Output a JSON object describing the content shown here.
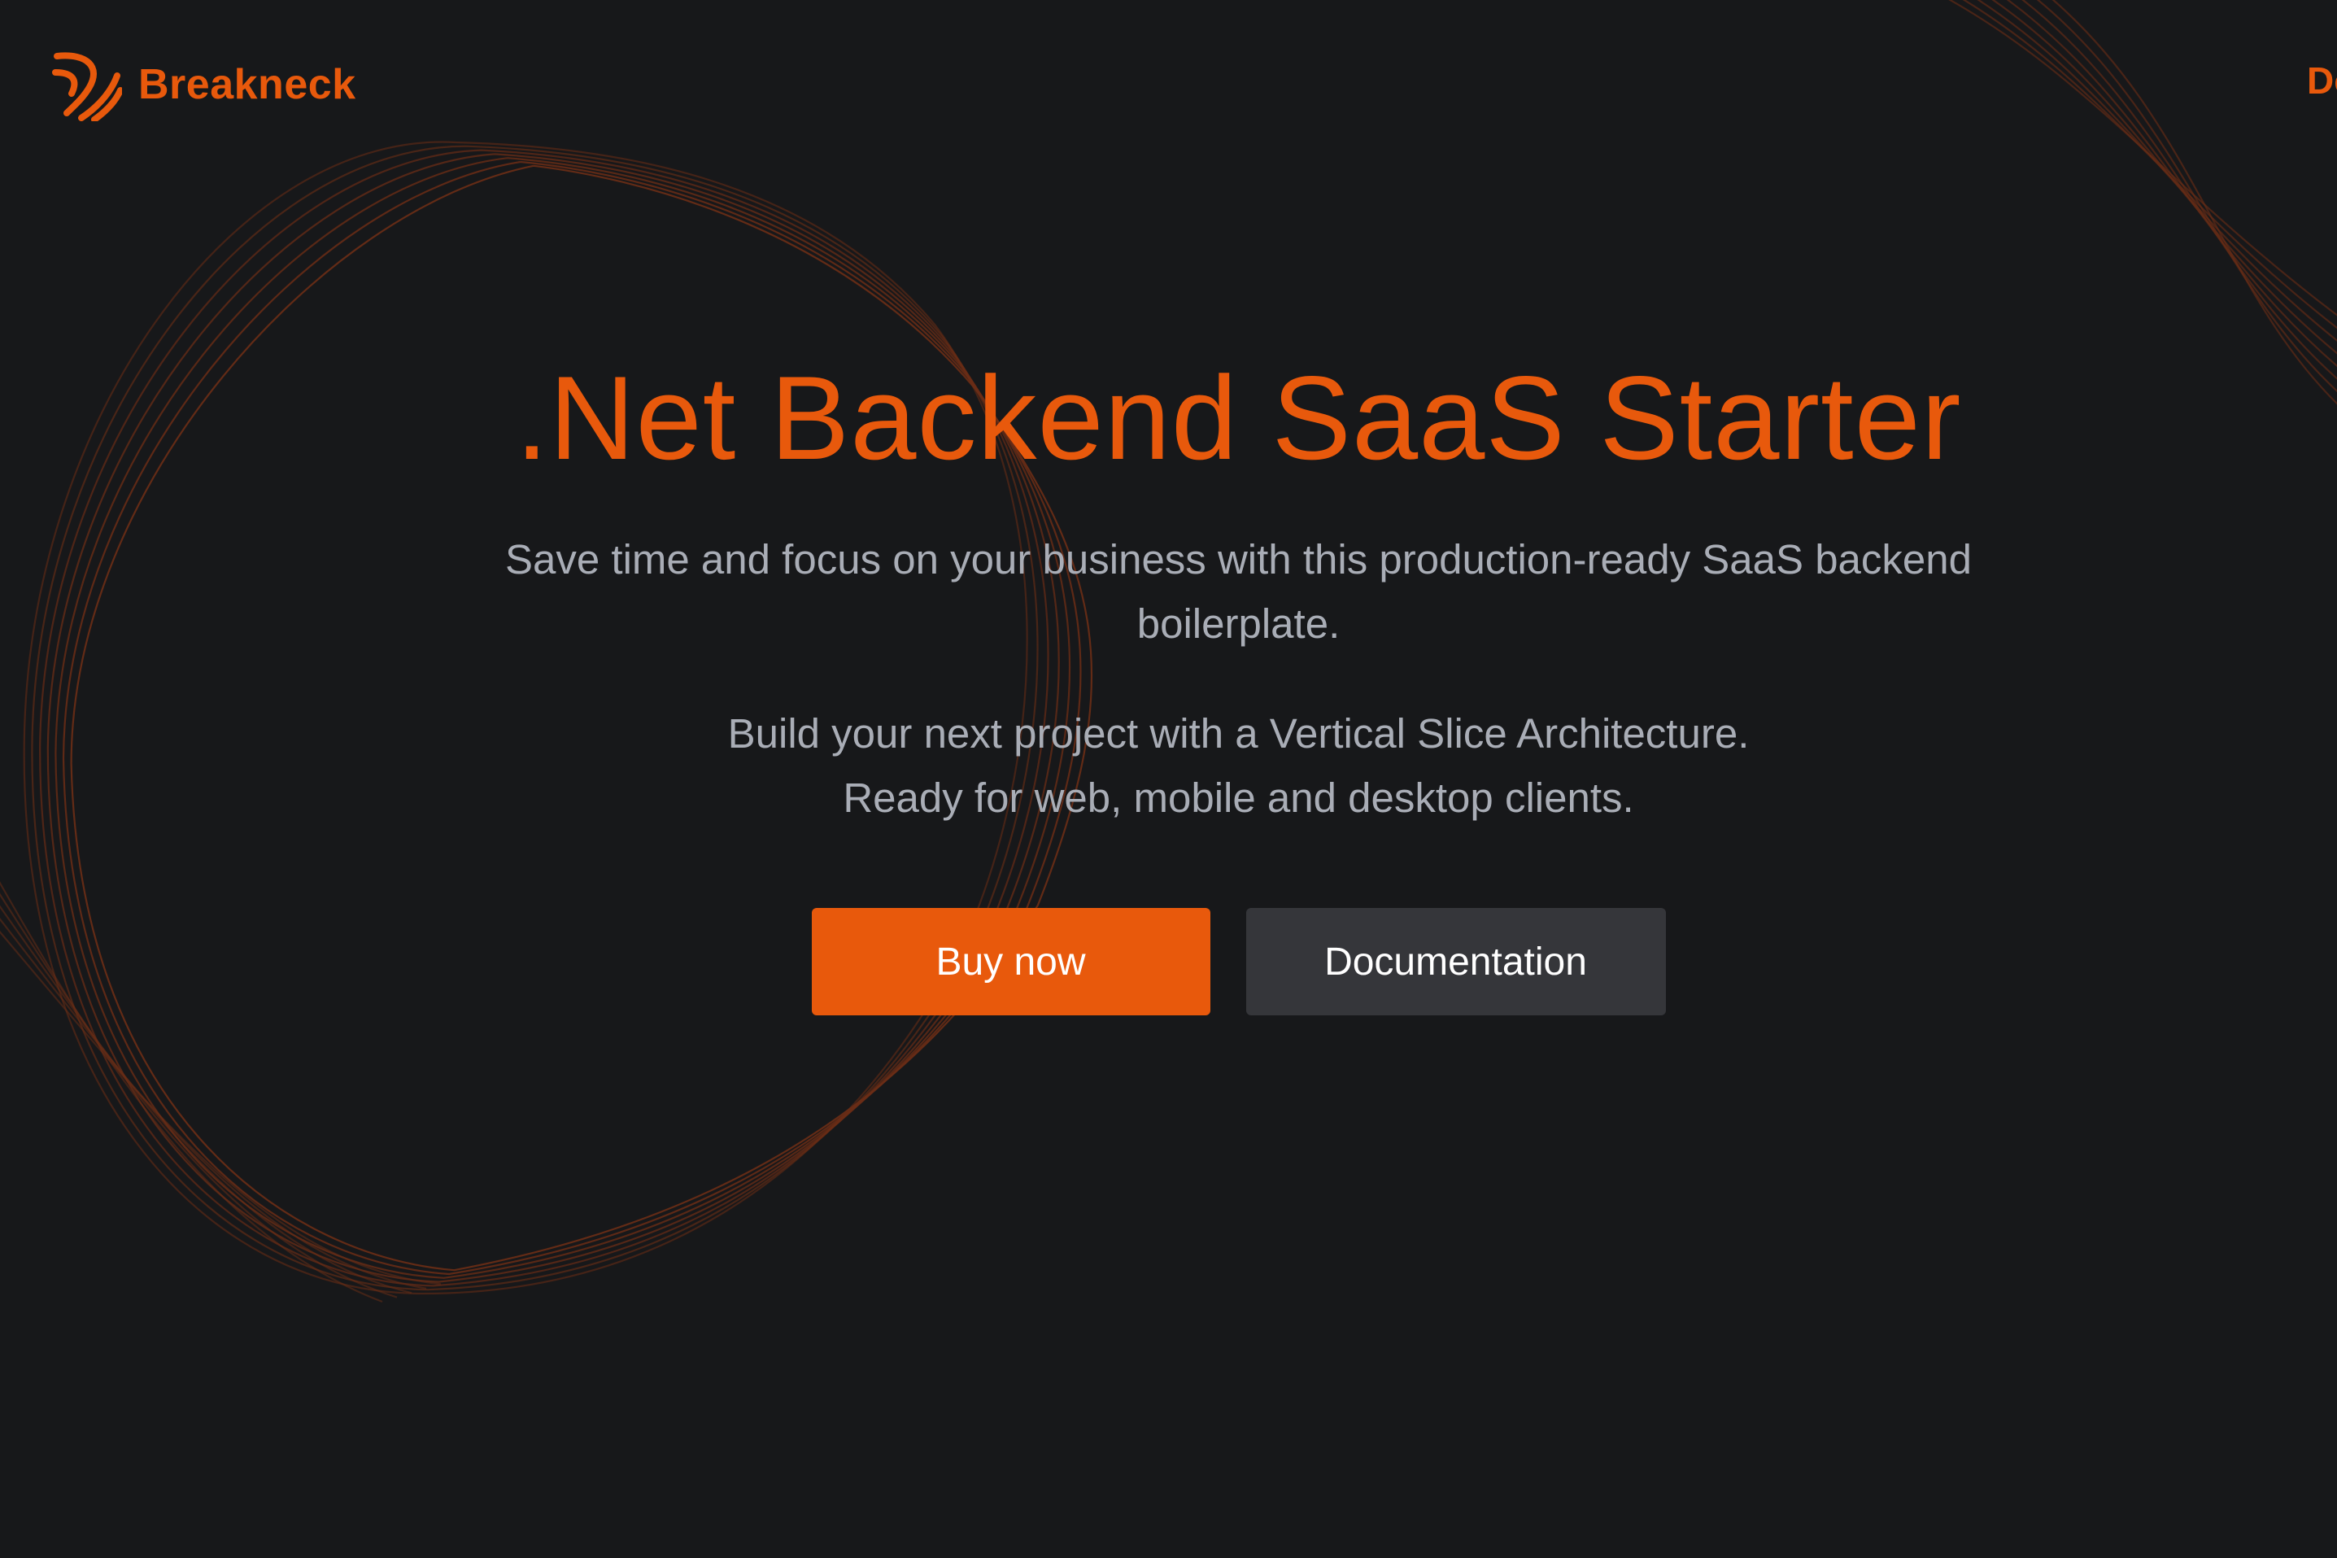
{
  "colors": {
    "accent": "#e8590c",
    "background": "#17181a",
    "body_text": "#a9adb6",
    "secondary_button": "#35363a",
    "wave": "#6b2d16"
  },
  "header": {
    "brand_name": "Breakneck",
    "logo_icon": "breakneck-logo-icon",
    "nav_link_label": "Do"
  },
  "hero": {
    "title": ".Net Backend SaaS Starter",
    "subtitle": "Save time and focus on your business with this production-ready SaaS backend boilerplate.",
    "description_line1": "Build your next project with a Vertical Slice Architecture.",
    "description_line2": "Ready for web, mobile and desktop clients."
  },
  "actions": {
    "buy_label": "Buy now",
    "docs_label": "Documentation"
  }
}
